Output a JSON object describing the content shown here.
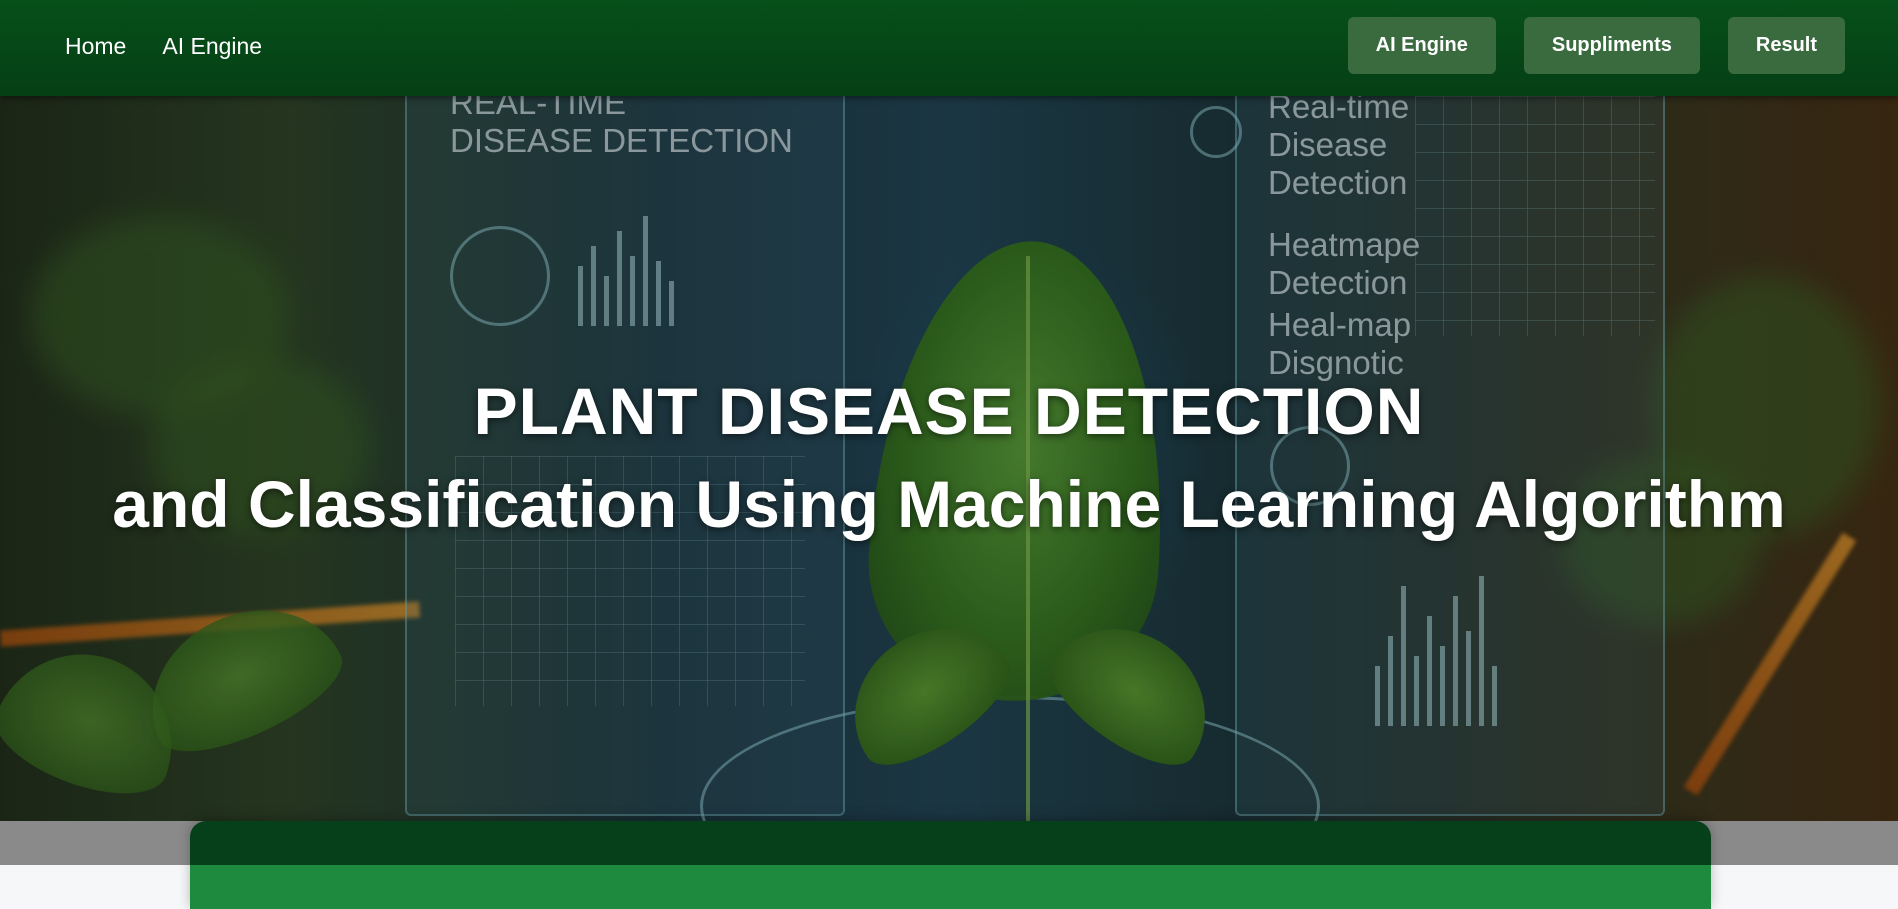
{
  "navbar": {
    "left_links": [
      "Home",
      "AI Engine"
    ],
    "right_buttons": [
      "AI Engine",
      "Suppliments",
      "Result"
    ],
    "colors": {
      "background": "#06501a",
      "button": "#3a6b3f",
      "text": "#ffffff"
    }
  },
  "hero": {
    "title_line1": "PLANT DISEASE DETECTION",
    "title_line2": "and Classification Using Machine Learning Algorithm",
    "background_text": {
      "panel_left": "REAL-TIME\nDISEASE DETECTION",
      "panel_right_1": "Real-time\nDisease\nDetection",
      "panel_right_2": "Heatmape\nDetection",
      "panel_right_3": "Heal-map\nDisgnotic"
    }
  },
  "card": {
    "colors": {
      "top": "#06401a",
      "bottom": "#1e8a3e"
    }
  }
}
